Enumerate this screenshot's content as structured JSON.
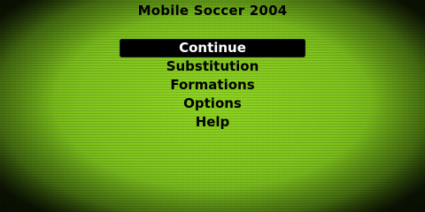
{
  "game": {
    "title": "Mobile Soccer 2004"
  },
  "menu": {
    "items": [
      {
        "label": "Continue",
        "selected": true
      },
      {
        "label": "Substitution",
        "selected": false
      },
      {
        "label": "Formations",
        "selected": false
      },
      {
        "label": "Options",
        "selected": false
      },
      {
        "label": "Help",
        "selected": false
      }
    ]
  },
  "colors": {
    "grass": "#7cc01a",
    "highlight_bg": "#000000",
    "highlight_text": "#ffffff",
    "text": "#000000"
  }
}
